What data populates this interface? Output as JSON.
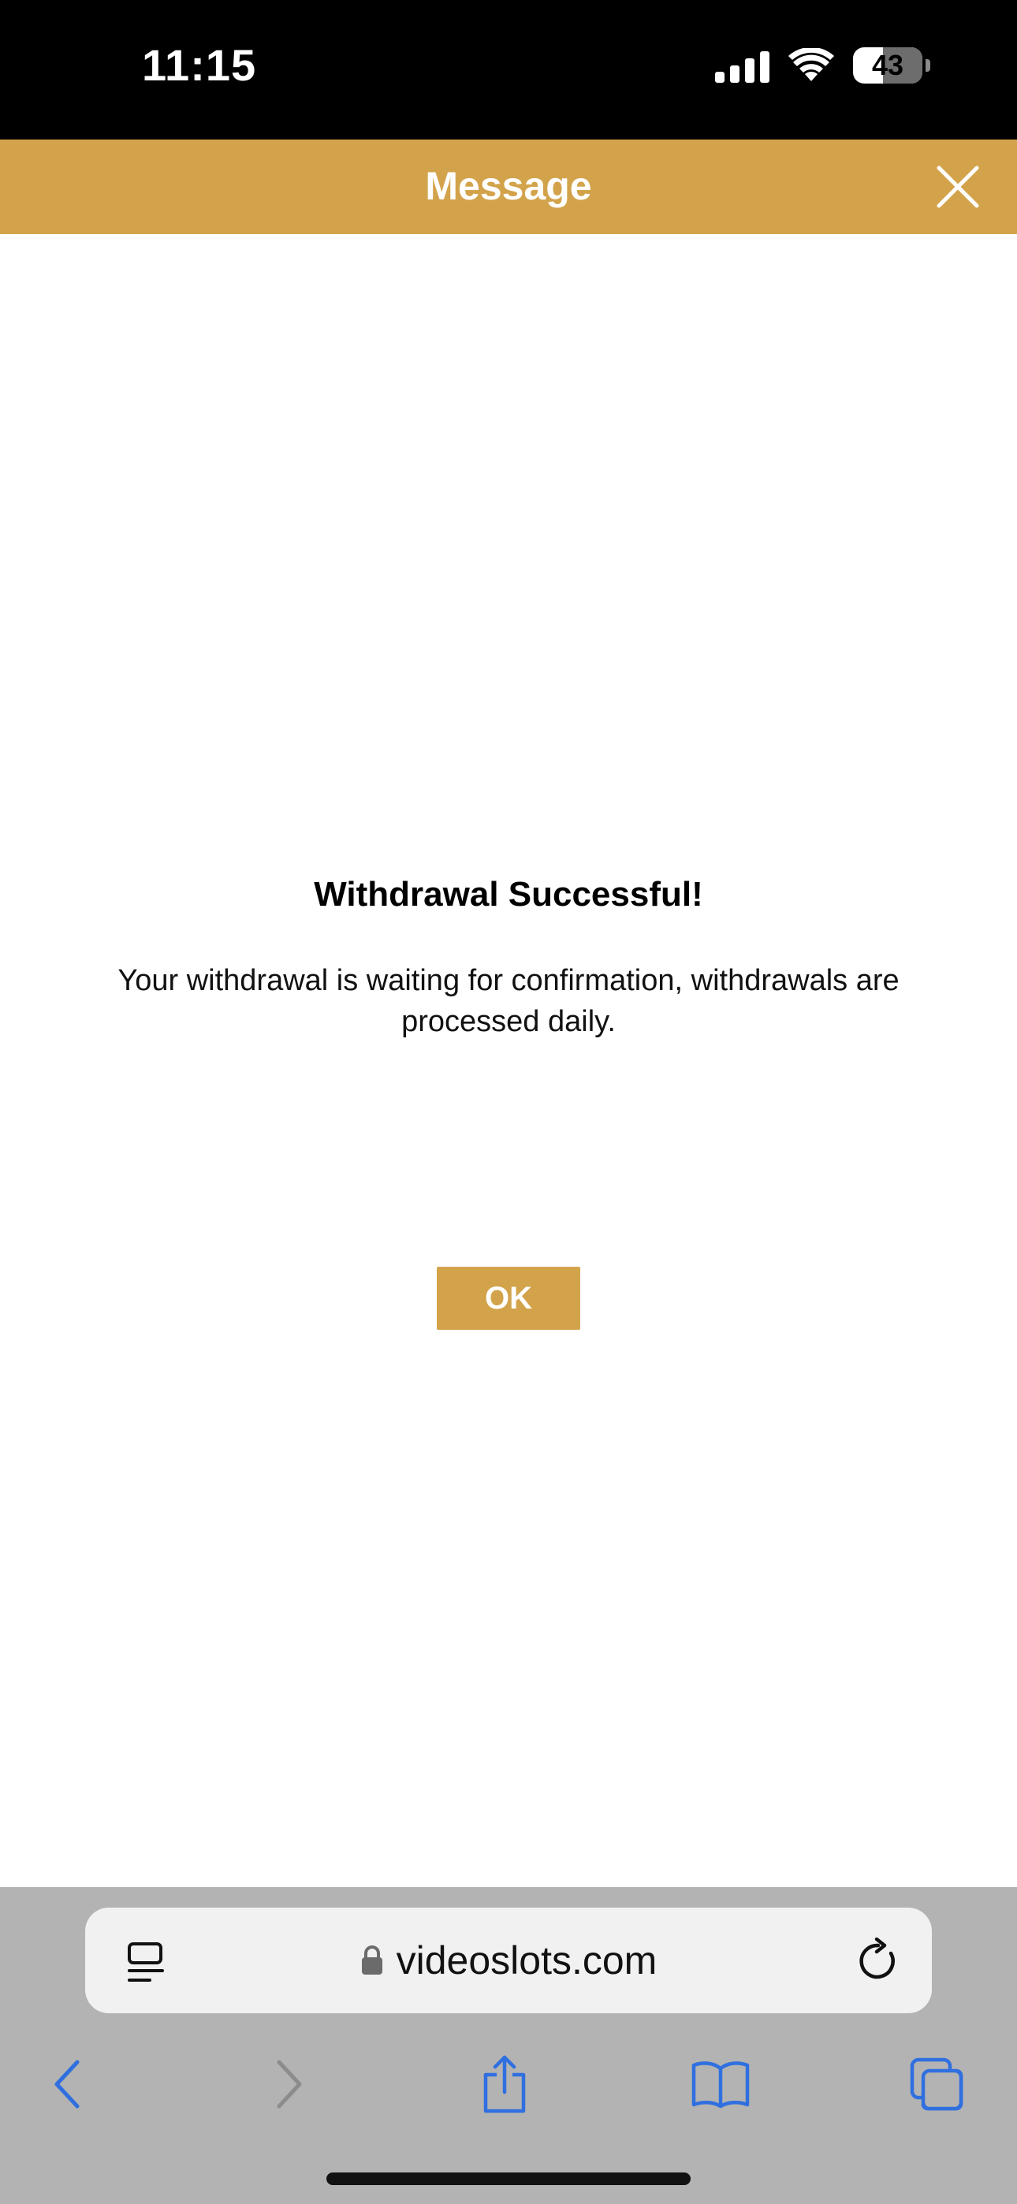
{
  "status_bar": {
    "time": "11:15",
    "battery_level": "43",
    "battery_fraction": 0.43,
    "icons": [
      "signal-icon",
      "wifi-icon",
      "battery-icon"
    ]
  },
  "header": {
    "title": "Message",
    "close_icon": "close-icon",
    "background_color": "#d3a34b"
  },
  "message": {
    "title": "Withdrawal Successful!",
    "body": "Your withdrawal is waiting for confirmation, withdrawals are processed daily.",
    "ok_label": "OK",
    "accent_color": "#d3a34b"
  },
  "browser": {
    "url": "videoslots.com",
    "icons": [
      "reader-icon",
      "lock-icon",
      "reload-icon",
      "back-icon",
      "forward-icon",
      "share-icon",
      "bookmarks-icon",
      "tabs-icon"
    ],
    "tint_color": "#2f6fe0"
  }
}
